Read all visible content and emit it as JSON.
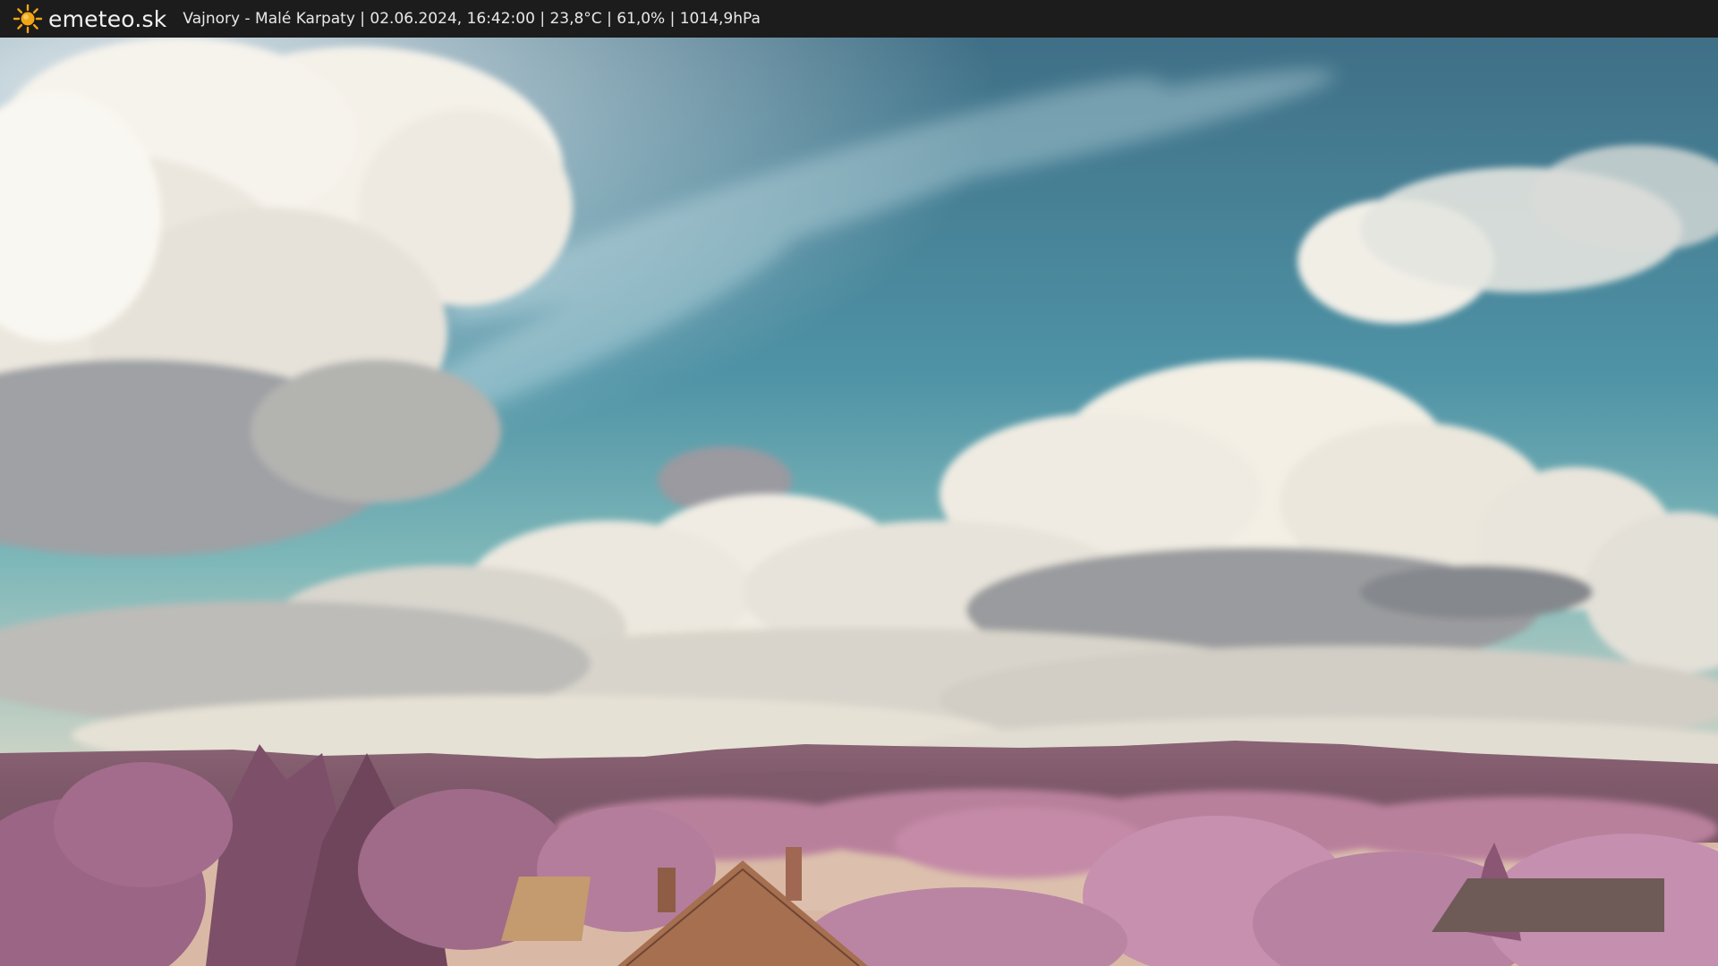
{
  "header": {
    "brand": "emeteo.sk",
    "brand_icon": "sun-icon",
    "caption": "Vajnory - Malé Karpaty | 02.06.2024, 16:42:00 | 23,8°C | 61,0% | 1014,9hPa"
  },
  "colors": {
    "bar_bg": "#1c1c1c",
    "sun": "#f2a516",
    "sky_top": "#4a7e92",
    "sky_bottom": "#5aa6b0",
    "cloud": "#f3efe6",
    "cloud_shadow": "#8b8f94",
    "hills": "#7a5566",
    "foliage": "#b27a98",
    "field": "#d9b9a6"
  }
}
